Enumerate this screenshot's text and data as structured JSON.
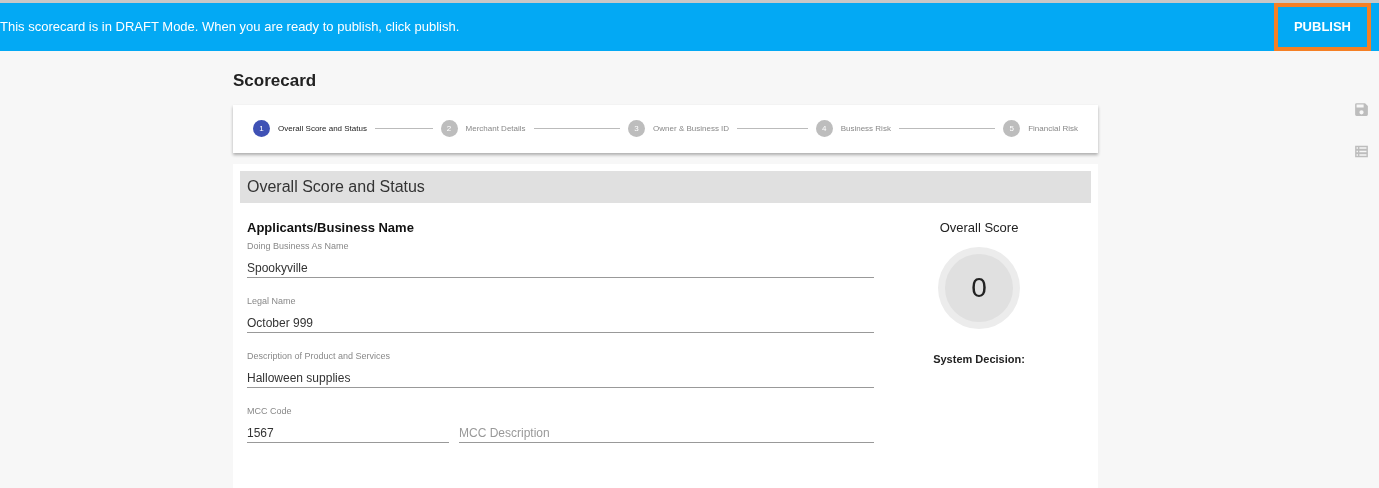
{
  "banner": {
    "message": "This scorecard is in DRAFT Mode. When you are ready to publish, click publish.",
    "button": "PUBLISH"
  },
  "page_title": "Scorecard",
  "steps": [
    {
      "number": "1",
      "label": "Overall Score and Status",
      "selected": true
    },
    {
      "number": "2",
      "label": "Merchant Details",
      "selected": false
    },
    {
      "number": "3",
      "label": "Owner & Business ID",
      "selected": false
    },
    {
      "number": "4",
      "label": "Business Risk",
      "selected": false
    },
    {
      "number": "5",
      "label": "Financial Risk",
      "selected": false
    }
  ],
  "section": {
    "title": "Overall Score and Status",
    "subtitle": "Applicants/Business Name",
    "fields": [
      {
        "label": "Doing Business As Name",
        "value": "Spookyville"
      },
      {
        "label": "Legal Name",
        "value": "October 999"
      },
      {
        "label": "Description of Product and Services",
        "value": "Halloween supplies"
      }
    ],
    "mcc": {
      "code_label": "MCC Code",
      "code_value": "1567",
      "description_placeholder": "MCC Description"
    },
    "score": {
      "title": "Overall Score",
      "value": "0",
      "decision_label": "System Decision:"
    }
  }
}
